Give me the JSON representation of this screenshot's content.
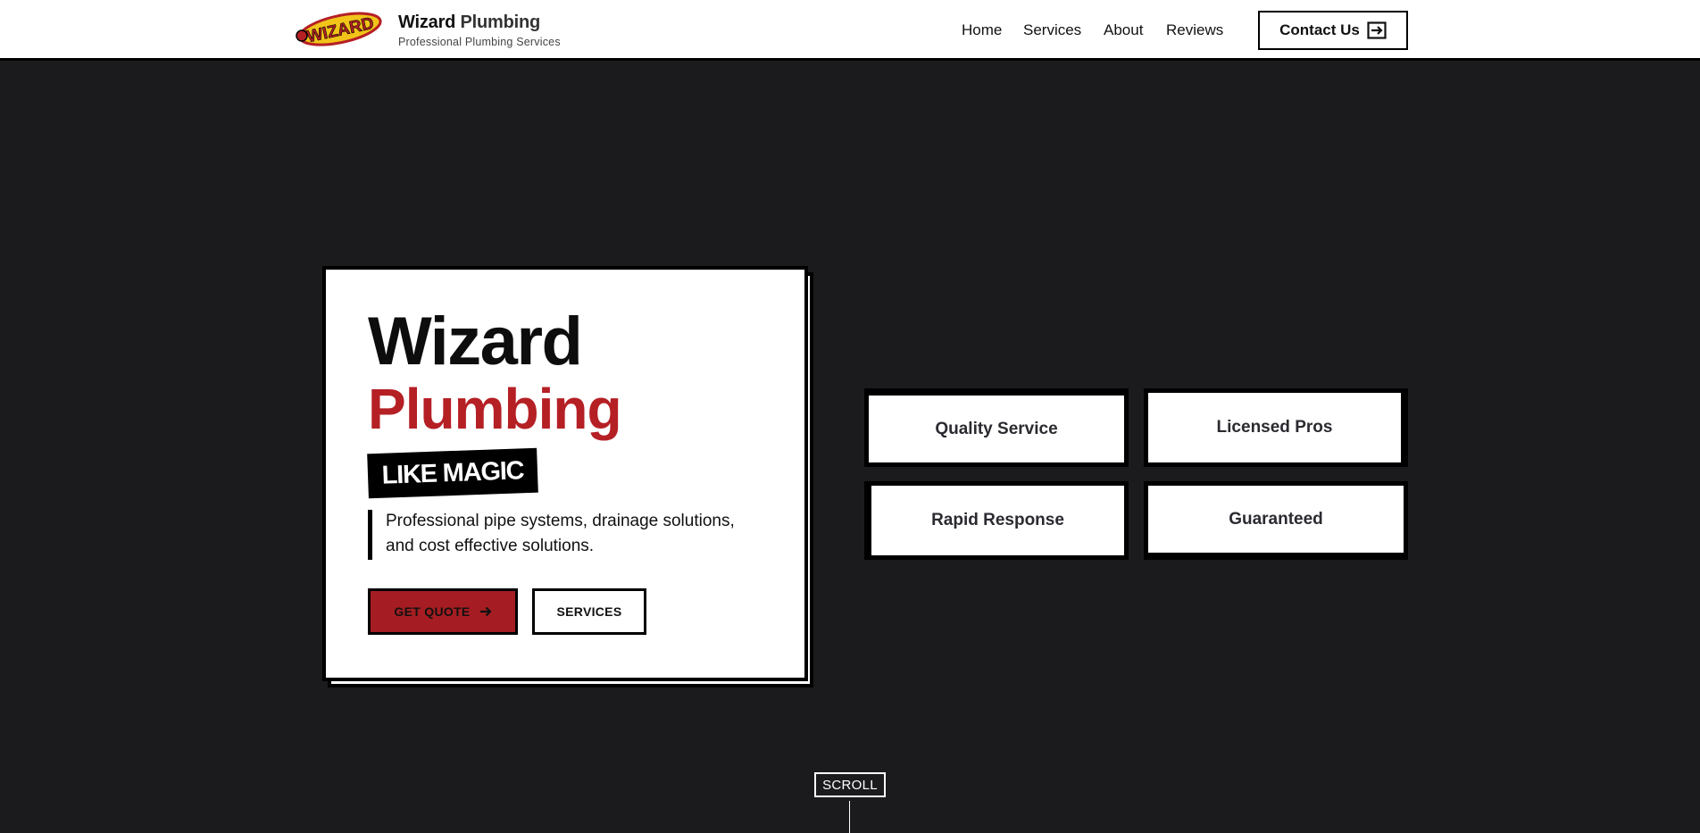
{
  "header": {
    "brand_bold": "Wizard",
    "brand_rest": "Plumbing",
    "brand_sub": "Professional Plumbing Services",
    "logo_text": "WIZARD",
    "nav": [
      "Home",
      "Services",
      "About",
      "Reviews"
    ],
    "contact_label": "Contact Us",
    "contact_icon": "arrow-right-box-icon"
  },
  "hero": {
    "title_line1": "Wizard",
    "title_line2": "Plumbing",
    "tagline": "LIKE MAGIC",
    "description": "Professional pipe systems, drainage solutions, and cost effective solutions.",
    "quote_label": "GET QUOTE",
    "services_label": "SERVICES"
  },
  "features": [
    "Quality Service",
    "Licensed Pros",
    "Rapid Response",
    "Guaranteed"
  ],
  "scroll_label": "SCROLL",
  "colors": {
    "background": "#1b1b1d",
    "accent_red": "#b52025",
    "button_red": "#a51d22",
    "logo_yellow": "#f2c419"
  }
}
